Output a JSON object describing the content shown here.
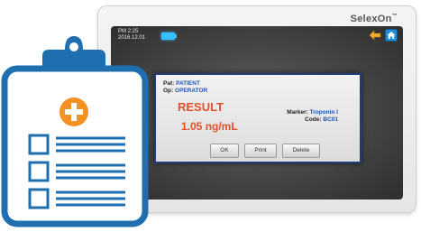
{
  "device": {
    "brand": "SelexOn",
    "brand_mark": "™"
  },
  "statusbar": {
    "time": "PM 2:25",
    "date": "2016.12.01"
  },
  "dialog": {
    "patient_key": "Pat:",
    "patient_value": "PATIENT",
    "operator_key": "Op:",
    "operator_value": "OPERATOR",
    "result_title": "RESULT",
    "result_value": "1.05 ng/mL",
    "marker_key": "Marker:",
    "marker_value": "Troponin I",
    "code_key": "Code:",
    "code_value": "BC01",
    "buttons": {
      "ok": "OK",
      "print": "Print",
      "delete": "Delete"
    }
  },
  "colors": {
    "clipboard_blue": "#1f6fb0",
    "plus_orange": "#f39221",
    "result_orange": "#e0522a",
    "dialog_border": "#1e3d7a",
    "battery_cyan": "#38c0ff",
    "home_blue": "#1f8ed8"
  },
  "icons": [
    "clipboard-icon",
    "plus-badge-icon",
    "battery-icon",
    "back-arrow-icon",
    "home-icon"
  ]
}
